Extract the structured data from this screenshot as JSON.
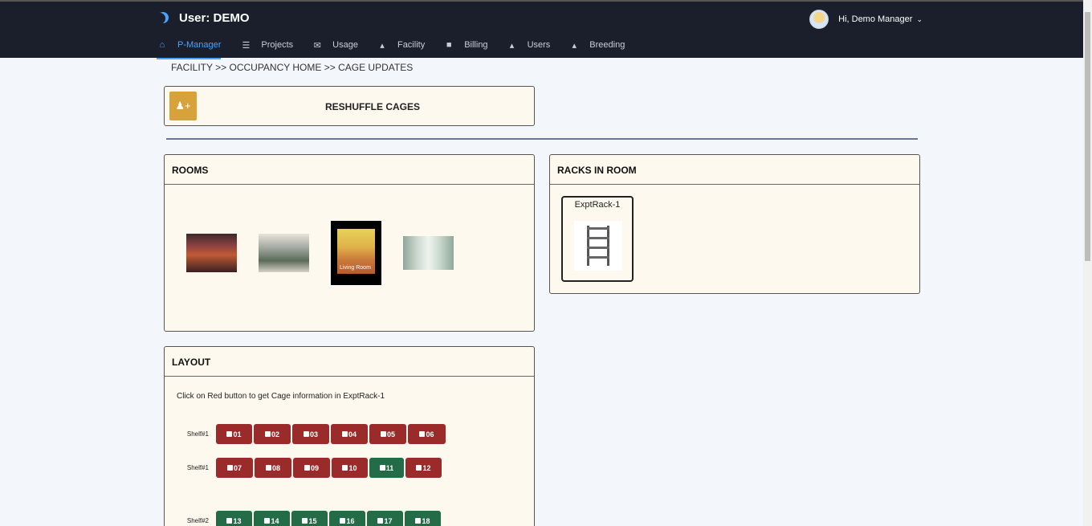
{
  "header": {
    "title": "User: DEMO",
    "greeting": "Hi, Demo Manager",
    "nav": [
      {
        "label": "P-Manager",
        "icon": "home-icon",
        "active": true
      },
      {
        "label": "Projects",
        "icon": "tasks-icon"
      },
      {
        "label": "Usage",
        "icon": "envelope-icon"
      },
      {
        "label": "Facility",
        "icon": "area-chart-icon"
      },
      {
        "label": "Billing",
        "icon": "wallet-icon"
      },
      {
        "label": "Users",
        "icon": "area-chart-icon"
      },
      {
        "label": "Breeding",
        "icon": "area-chart-icon"
      }
    ]
  },
  "breadcrumb": "FACILITY >> OCCUPANCY HOME >> CAGE UPDATES",
  "reshuffle": {
    "label": "RESHUFFLE CAGES"
  },
  "rooms": {
    "title": "ROOMS",
    "room3_caption": "Living Room"
  },
  "racks": {
    "title": "RACKS IN ROOM",
    "items": [
      {
        "name": "ExptRack-1"
      }
    ]
  },
  "layout": {
    "title": "LAYOUT",
    "hint": "Click on Red button to get Cage information in ExptRack-1",
    "rows": [
      {
        "shelf": "Shelf#1",
        "cages": [
          {
            "id": "01",
            "status": "red"
          },
          {
            "id": "02",
            "status": "red"
          },
          {
            "id": "03",
            "status": "red"
          },
          {
            "id": "04",
            "status": "red"
          },
          {
            "id": "05",
            "status": "red"
          },
          {
            "id": "06",
            "status": "red"
          }
        ]
      },
      {
        "shelf": "Shelf#1",
        "cages": [
          {
            "id": "07",
            "status": "red"
          },
          {
            "id": "08",
            "status": "red"
          },
          {
            "id": "09",
            "status": "red"
          },
          {
            "id": "10",
            "status": "red"
          },
          {
            "id": "11",
            "status": "green"
          },
          {
            "id": "12",
            "status": "red"
          }
        ]
      },
      {
        "shelf": "Shelf#2",
        "cages": [
          {
            "id": "13",
            "status": "green"
          },
          {
            "id": "14",
            "status": "green"
          },
          {
            "id": "15",
            "status": "green"
          },
          {
            "id": "16",
            "status": "green"
          },
          {
            "id": "17",
            "status": "green"
          },
          {
            "id": "18",
            "status": "green"
          }
        ]
      }
    ]
  },
  "colors": {
    "accent": "#4aa3ff",
    "cage_red": "#9b2a2a",
    "cage_green": "#246b47",
    "reshuffle": "#d8a23a"
  }
}
